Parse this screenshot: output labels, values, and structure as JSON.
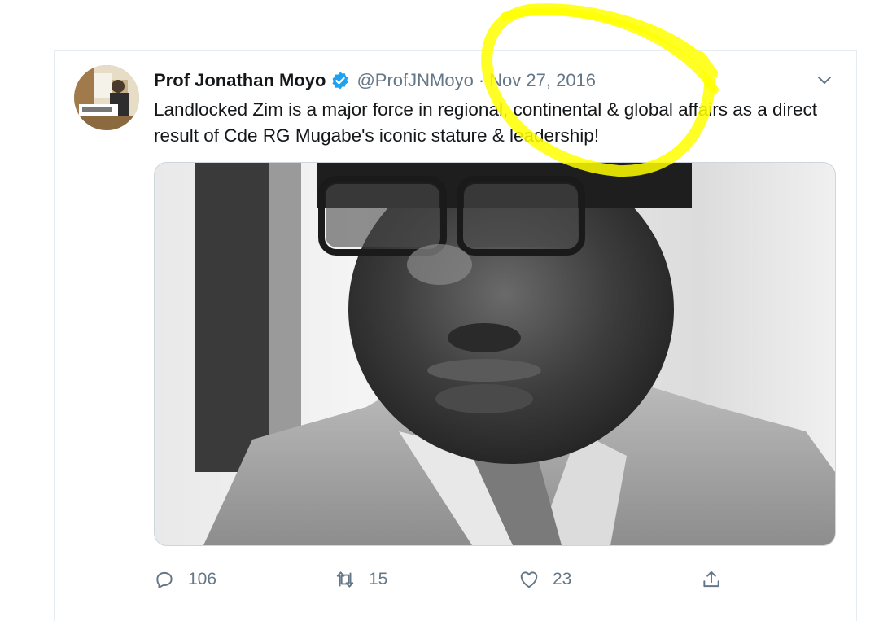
{
  "tweet": {
    "author_name": "Prof Jonathan Moyo",
    "handle": "@ProfJNMoyo",
    "separator": "·",
    "date": "Nov 27, 2016",
    "text": "Landlocked Zim is a major force in regional, continental & global affairs as a direct result of Cde RG Mugabe's iconic stature & leadership!",
    "verified": true
  },
  "actions": {
    "reply_count": "106",
    "retweet_count": "15",
    "like_count": "23"
  },
  "icons": {
    "reply": "reply-icon",
    "retweet": "retweet-icon",
    "like": "heart-icon",
    "share": "share-icon",
    "verified": "verified-badge-icon",
    "more": "chevron-down-icon"
  },
  "colors": {
    "icon_gray": "#657786",
    "verified_blue": "#1da1f2",
    "highlight_yellow": "#ffff00"
  }
}
